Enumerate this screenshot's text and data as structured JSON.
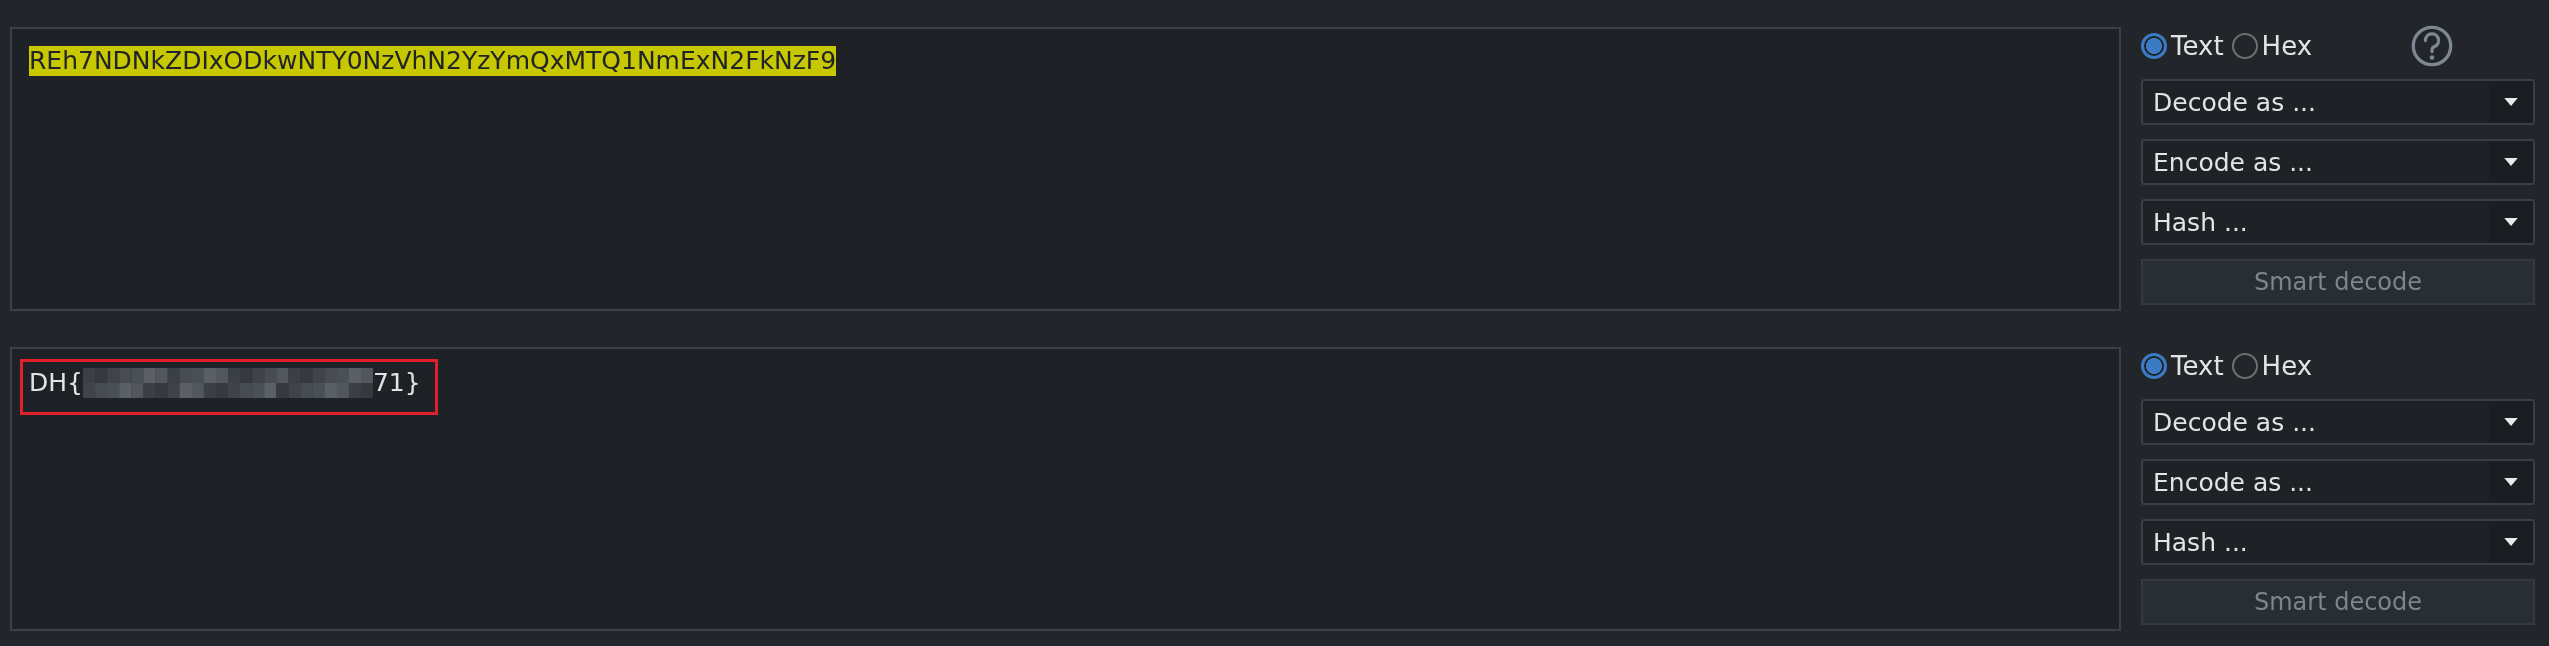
{
  "panels": [
    {
      "editor": {
        "text": "REh7NDNkZDIxODkwNTY0NzVhN2YzYmQxMTQ1NmExN2FkNzF9",
        "highlighted": true
      },
      "modes": [
        {
          "label": "Text",
          "selected": true
        },
        {
          "label": "Hex",
          "selected": false
        }
      ],
      "help": true,
      "dropdowns": [
        "Decode as ...",
        "Encode as ...",
        "Hash ..."
      ],
      "smart_decode": {
        "label": "Smart decode",
        "disabled": true
      }
    },
    {
      "editor": {
        "text": "DH{",
        "text_end": "71}",
        "outlined": true,
        "redacted": true
      },
      "modes": [
        {
          "label": "Text",
          "selected": true
        },
        {
          "label": "Hex",
          "selected": false
        }
      ],
      "dropdowns": [
        "Decode as ...",
        "Encode as ...",
        "Hash ..."
      ],
      "smart_decode": {
        "label": "Smart decode",
        "disabled": true
      }
    }
  ]
}
